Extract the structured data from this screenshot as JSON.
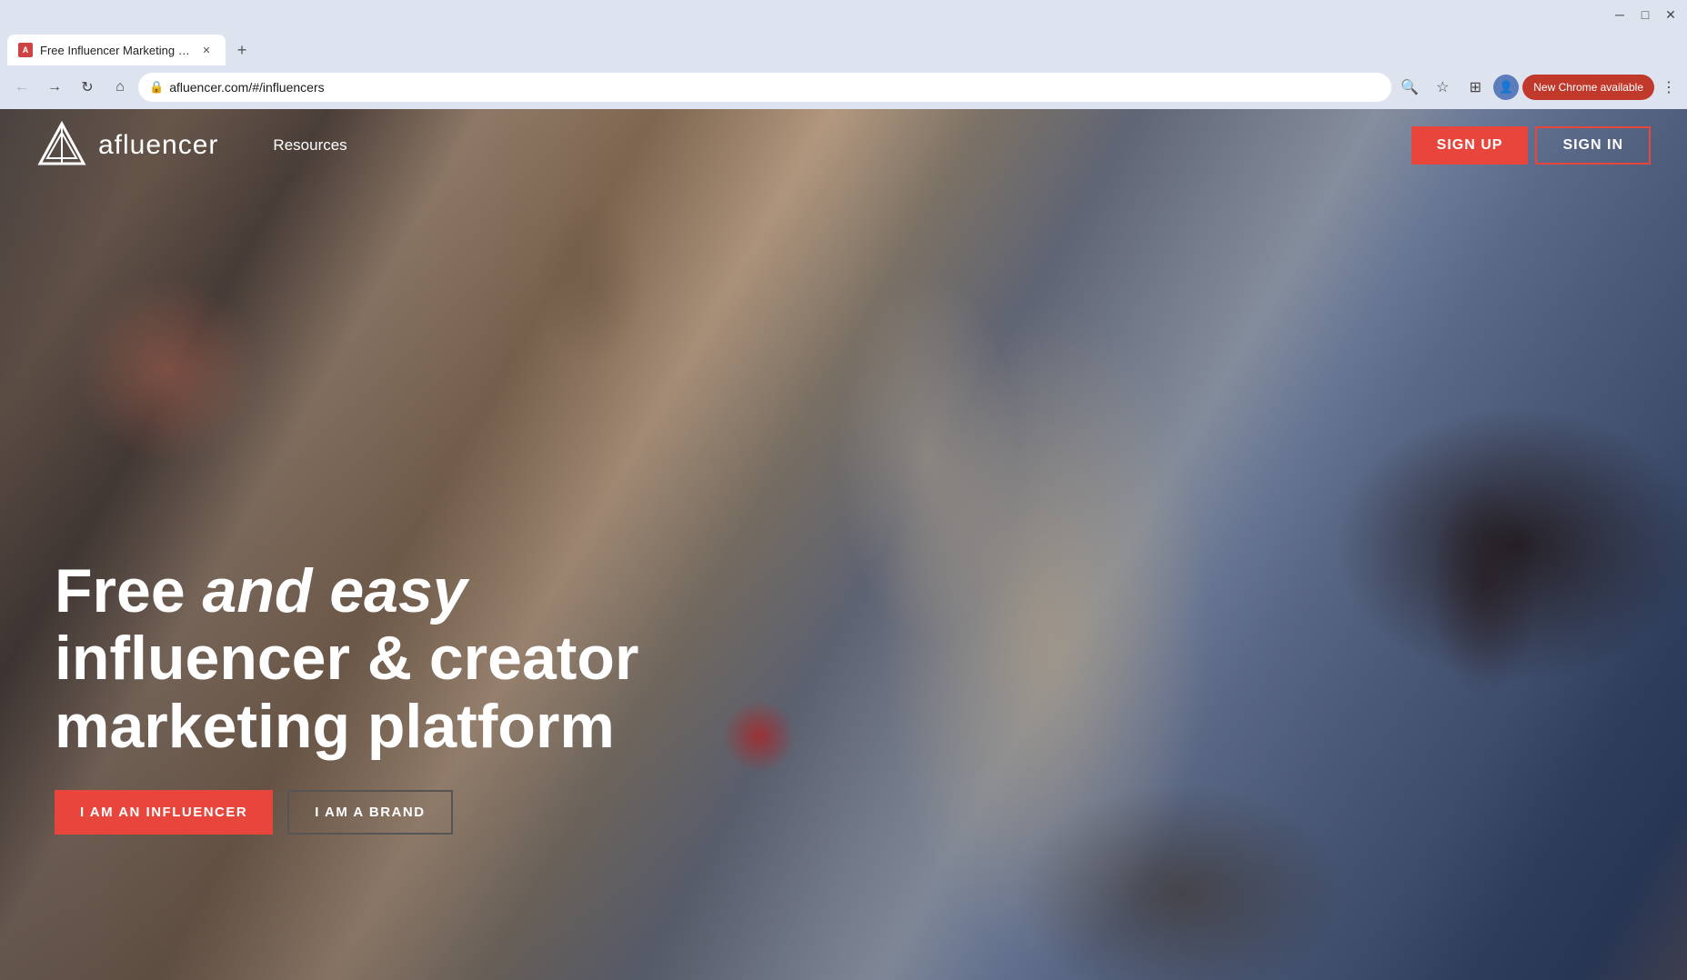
{
  "os": {
    "minimize_label": "minimize",
    "restore_label": "restore",
    "close_label": "close"
  },
  "browser": {
    "tab": {
      "title": "Free Influencer Marketing Platf...",
      "favicon": "A"
    },
    "new_tab_label": "+",
    "nav": {
      "back_label": "←",
      "forward_label": "→",
      "reload_label": "↻",
      "home_label": "⌂",
      "address": "afluencer.com/#/influencers",
      "zoom_label": "🔍",
      "bookmark_label": "☆",
      "extensions_label": "⊞",
      "profile_label": "👤",
      "new_chrome": "New Chrome available",
      "menu_label": "⋮"
    }
  },
  "page": {
    "navbar": {
      "logo_text": "afluencer",
      "nav_links": [
        {
          "label": "Resources"
        }
      ],
      "sign_up_label": "SIGN UP",
      "sign_in_label": "SIGN IN"
    },
    "hero": {
      "title_line1": "Free ",
      "title_italic": "and easy",
      "title_line2": "influencer & creator",
      "title_line3": "marketing platform",
      "btn_influencer": "I AM AN INFLUENCER",
      "btn_brand": "I AM A BRAND"
    }
  }
}
